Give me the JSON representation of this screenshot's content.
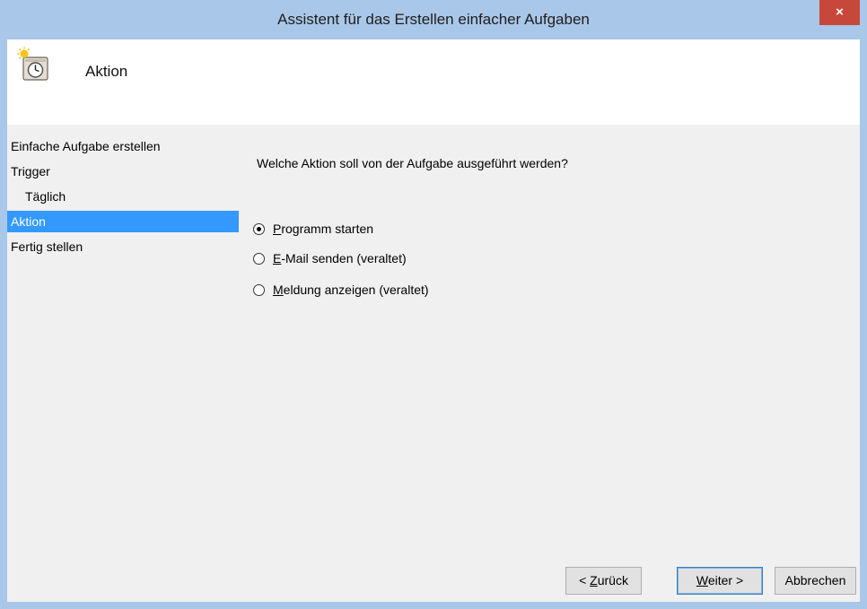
{
  "window": {
    "title": "Assistent für das Erstellen einfacher Aufgaben",
    "close_label": "×"
  },
  "header": {
    "title": "Aktion",
    "icon": "task-scheduler-clock-icon"
  },
  "sidebar": {
    "items": [
      {
        "label": "Einfache Aufgabe erstellen",
        "selected": false
      },
      {
        "label": "Trigger",
        "selected": false
      },
      {
        "label": "Täglich",
        "selected": false,
        "indent": true
      },
      {
        "label": "Aktion",
        "selected": true
      },
      {
        "label": "Fertig stellen",
        "selected": false
      }
    ]
  },
  "main": {
    "question": "Welche Aktion soll von der Aufgabe ausgeführt werden?",
    "options": [
      {
        "mnemonic": "P",
        "rest": "rogramm starten",
        "checked": true
      },
      {
        "mnemonic": "E",
        "rest": "-Mail senden (veraltet)",
        "checked": false
      },
      {
        "mnemonic": "M",
        "rest": "eldung anzeigen (veraltet)",
        "checked": false
      }
    ]
  },
  "footer": {
    "back_prefix": "< ",
    "back_mnemonic": "Z",
    "back_rest": "urück",
    "next_mnemonic": "W",
    "next_rest": "eiter >",
    "cancel_label": "Abbrechen"
  },
  "colors": {
    "title_bar": "#a9c7e8",
    "close_button": "#c7483b",
    "selection": "#3399ff",
    "client_background": "#f0f0f0"
  }
}
